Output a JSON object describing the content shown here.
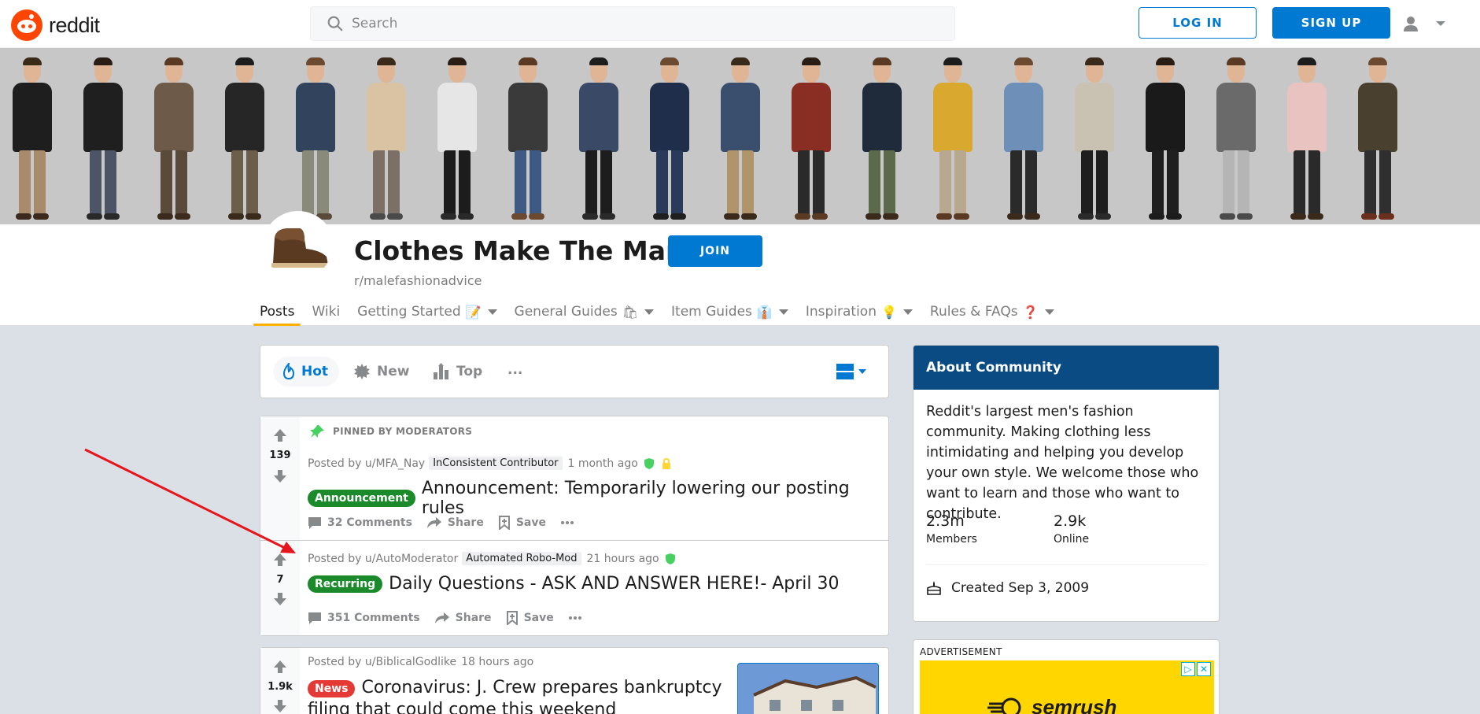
{
  "header": {
    "logo_text": "reddit",
    "search_placeholder": "Search",
    "login_label": "LOG IN",
    "signup_label": "SIGN UP"
  },
  "community": {
    "title": "Clothes Make The Man",
    "subreddit": "r/malefashionadvice",
    "join_label": "JOIN",
    "tabs": [
      {
        "label": "Posts",
        "emoji": ""
      },
      {
        "label": "Wiki",
        "emoji": ""
      },
      {
        "label": "Getting Started",
        "emoji": "📝"
      },
      {
        "label": "General Guides",
        "emoji": "🛍"
      },
      {
        "label": "Item Guides",
        "emoji": "👔"
      },
      {
        "label": "Inspiration",
        "emoji": "💡"
      },
      {
        "label": "Rules & FAQs",
        "emoji": "❓"
      }
    ]
  },
  "sort": {
    "hot": "Hot",
    "new": "New",
    "top": "Top",
    "more": "..."
  },
  "posts": [
    {
      "votes": "139",
      "pinned_label": "PINNED BY MODERATORS",
      "posted_by": "Posted by u/MFA_Nay",
      "user_flair": "InConsistent Contributor",
      "time": "1 month ago",
      "flair": "Announcement",
      "title": "Announcement: Temporarily lowering our posting rules",
      "comments": "32 Comments",
      "share": "Share",
      "save": "Save"
    },
    {
      "votes": "7",
      "posted_by": "Posted by u/AutoModerator",
      "user_flair": "Automated Robo-Mod",
      "time": "21 hours ago",
      "flair": "Recurring",
      "title": "Daily Questions - ASK AND ANSWER HERE!- April 30",
      "comments": "351 Comments",
      "share": "Share",
      "save": "Save"
    },
    {
      "votes": "1.9k",
      "posted_by": "Posted by u/BiblicalGodlike",
      "time": "18 hours ago",
      "flair": "News",
      "title_line1": "Coronavirus: J. Crew prepares bankruptcy",
      "title_line2": "filing that could come this weekend"
    }
  ],
  "about": {
    "heading": "About Community",
    "description": "Reddit's largest men's fashion community. Making clothing less intimidating and helping you develop your own style. We welcome those who want to learn and those who want to contribute.",
    "members_count": "2.3m",
    "members_label": "Members",
    "online_count": "2.9k",
    "online_label": "Online",
    "created": "Created Sep 3, 2009"
  },
  "ad": {
    "label": "ADVERTISEMENT",
    "brand": "semrush"
  },
  "colors": {
    "accent": "#0079d3",
    "brand": "#ff4500",
    "announcement_flair": "#1b8a2a",
    "news_flair": "#e53935",
    "about_header": "#0b4b84",
    "annotation_arrow": "#e8141c"
  }
}
